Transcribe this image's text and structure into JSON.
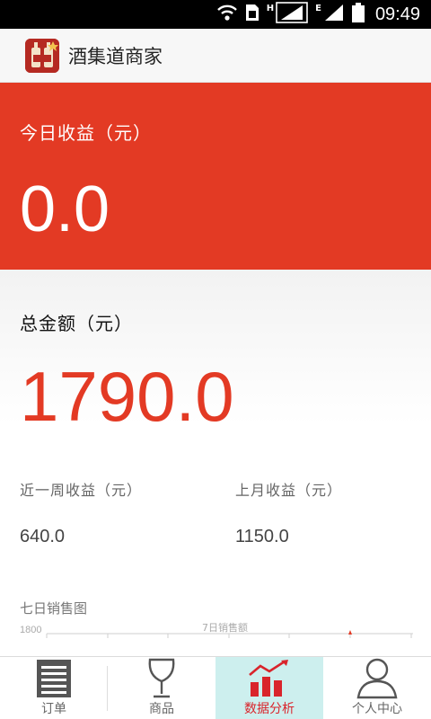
{
  "status_bar": {
    "network_h": "H",
    "network_e": "E",
    "time": "09:49",
    "icons": [
      "wifi-icon",
      "sim-icon",
      "signal-icon",
      "signal-icon",
      "battery-icon"
    ]
  },
  "header": {
    "title": "酒集道商家",
    "logo_icon": "wine-bottles-logo",
    "brand_color": "#e33a24"
  },
  "today_income": {
    "label": "今日收益（元）",
    "value": "0.0"
  },
  "total": {
    "label": "总金额（元）",
    "value": "1790.0"
  },
  "weekly": {
    "label": "近一周收益（元）",
    "value": "640.0"
  },
  "last_month": {
    "label": "上月收益（元）",
    "value": "1150.0"
  },
  "chart": {
    "title": "七日销售图"
  },
  "chart_data": {
    "type": "line",
    "title": "7日销售额",
    "ytick_top": "1800",
    "x": [],
    "series": []
  },
  "tabs": [
    {
      "label": "订单",
      "icon": "order-list-icon",
      "active": false
    },
    {
      "label": "商品",
      "icon": "wine-glass-icon",
      "active": false
    },
    {
      "label": "数据分析",
      "icon": "bar-chart-icon",
      "active": true
    },
    {
      "label": "个人中心",
      "icon": "person-icon",
      "active": false
    }
  ],
  "colors": {
    "accent": "#e33a24",
    "active_tab_bg": "#cdefee",
    "active_tab_text": "#d9242b"
  }
}
